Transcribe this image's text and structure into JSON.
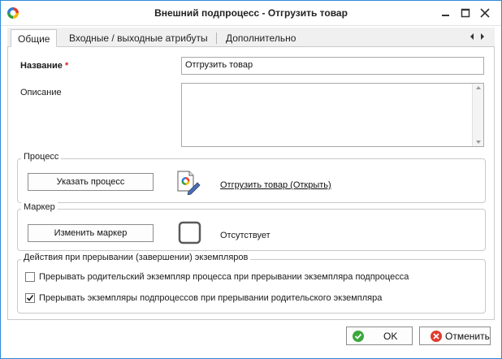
{
  "window": {
    "title": "Внешний подпроцесс - Отгрузить товар",
    "accent_color": "#2d8bd8"
  },
  "tabs": [
    {
      "label": "Общие",
      "active": true
    },
    {
      "label": "Входные / выходные атрибуты",
      "active": false
    },
    {
      "label": "Дополнительно",
      "active": false
    }
  ],
  "form": {
    "name_label": "Название",
    "required_mark": "*",
    "name_value": "Отгрузить товар",
    "description_label": "Описание",
    "description_value": ""
  },
  "process_group": {
    "title": "Процесс",
    "button_label": "Указать процесс",
    "link_text": "Отгрузить товар (Открыть)",
    "icon": "process-file-edit-icon"
  },
  "marker_group": {
    "title": "Маркер",
    "button_label": "Изменить маркер",
    "marker_status": "Отсутствует",
    "icon": "empty-marker-icon"
  },
  "actions_group": {
    "title": "Действия при прерывании (завершении) экземпляров",
    "checkboxes": [
      {
        "label": "Прерывать родительский экземпляр процесса при прерывании экземпляра подпроцесса",
        "checked": false
      },
      {
        "label": "Прерывать экземпляры подпроцессов при прерывании родительского экземпляра",
        "checked": true
      }
    ]
  },
  "footer": {
    "ok_label": "OK",
    "cancel_label": "Отменить",
    "ok_icon": "check-circle-icon",
    "cancel_icon": "cancel-circle-icon"
  }
}
